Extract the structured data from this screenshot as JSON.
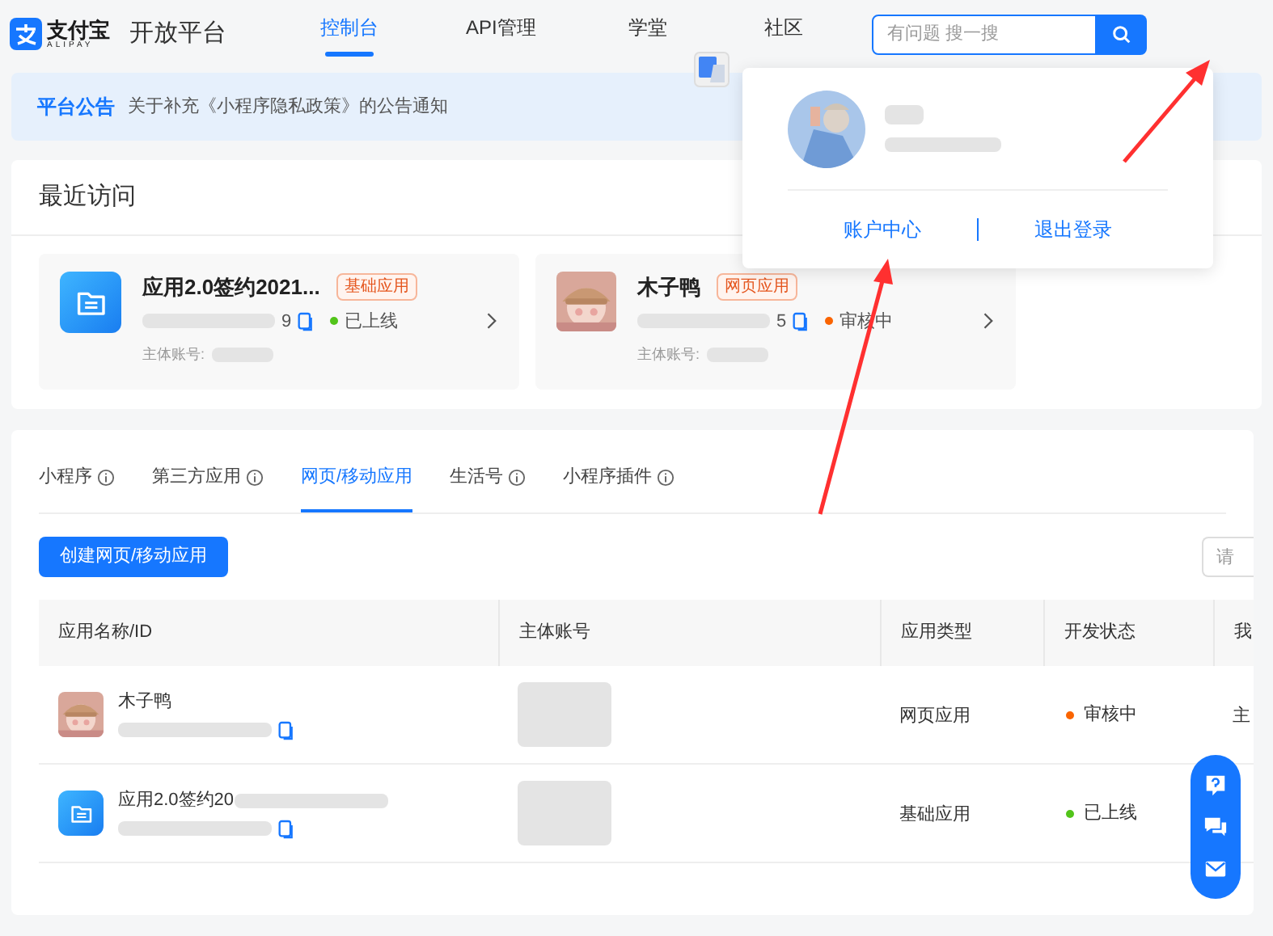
{
  "header": {
    "logo_main": "支付宝",
    "logo_sub": "ALIPAY",
    "product": "开放平台",
    "nav": [
      {
        "label": "控制台",
        "selected": true
      },
      {
        "label": "API管理",
        "selected": false
      },
      {
        "label": "学堂",
        "selected": false
      },
      {
        "label": "社区",
        "selected": false
      }
    ],
    "search": {
      "placeholder": "有问题 搜一搜"
    }
  },
  "announcement": {
    "tag": "平台公告",
    "text": "关于补充《小程序隐私政策》的公告通知"
  },
  "account_menu": {
    "actions": [
      "账户中心",
      "退出登录"
    ]
  },
  "recent": {
    "title": "最近访问",
    "cards": [
      {
        "kind": "app",
        "name": "应用2.0签约2021...",
        "badge": "基础应用",
        "id_tail": "9",
        "status": "已上线",
        "color": "#52c41a",
        "owner_label": "主体账号:"
      },
      {
        "kind": "picture",
        "name": "木子鸭",
        "badge": "网页应用",
        "id_tail": "5",
        "status": "审核中",
        "color": "#fa6400",
        "owner_label": "主体账号:"
      }
    ]
  },
  "apps": {
    "tabs": [
      {
        "label": "小程序",
        "info": true,
        "selected": false
      },
      {
        "label": "第三方应用",
        "info": true,
        "selected": false
      },
      {
        "label": "网页/移动应用",
        "info": false,
        "selected": true
      },
      {
        "label": "生活号",
        "info": true,
        "selected": false
      },
      {
        "label": "小程序插件",
        "info": true,
        "selected": false
      }
    ],
    "create_button": "创建网页/移动应用",
    "filter_placeholder": "请",
    "columns": [
      "应用名称/ID",
      "主体账号",
      "应用类型",
      "开发状态",
      "我"
    ],
    "rows": [
      {
        "kind": "picture",
        "name": "木子鸭",
        "type": "网页应用",
        "status": "审核中",
        "color": "#fa6400",
        "column_5": "主"
      },
      {
        "kind": "app",
        "name": "应用2.0签约20",
        "type": "基础应用",
        "status": "已上线",
        "color": "#52c41a"
      }
    ]
  }
}
